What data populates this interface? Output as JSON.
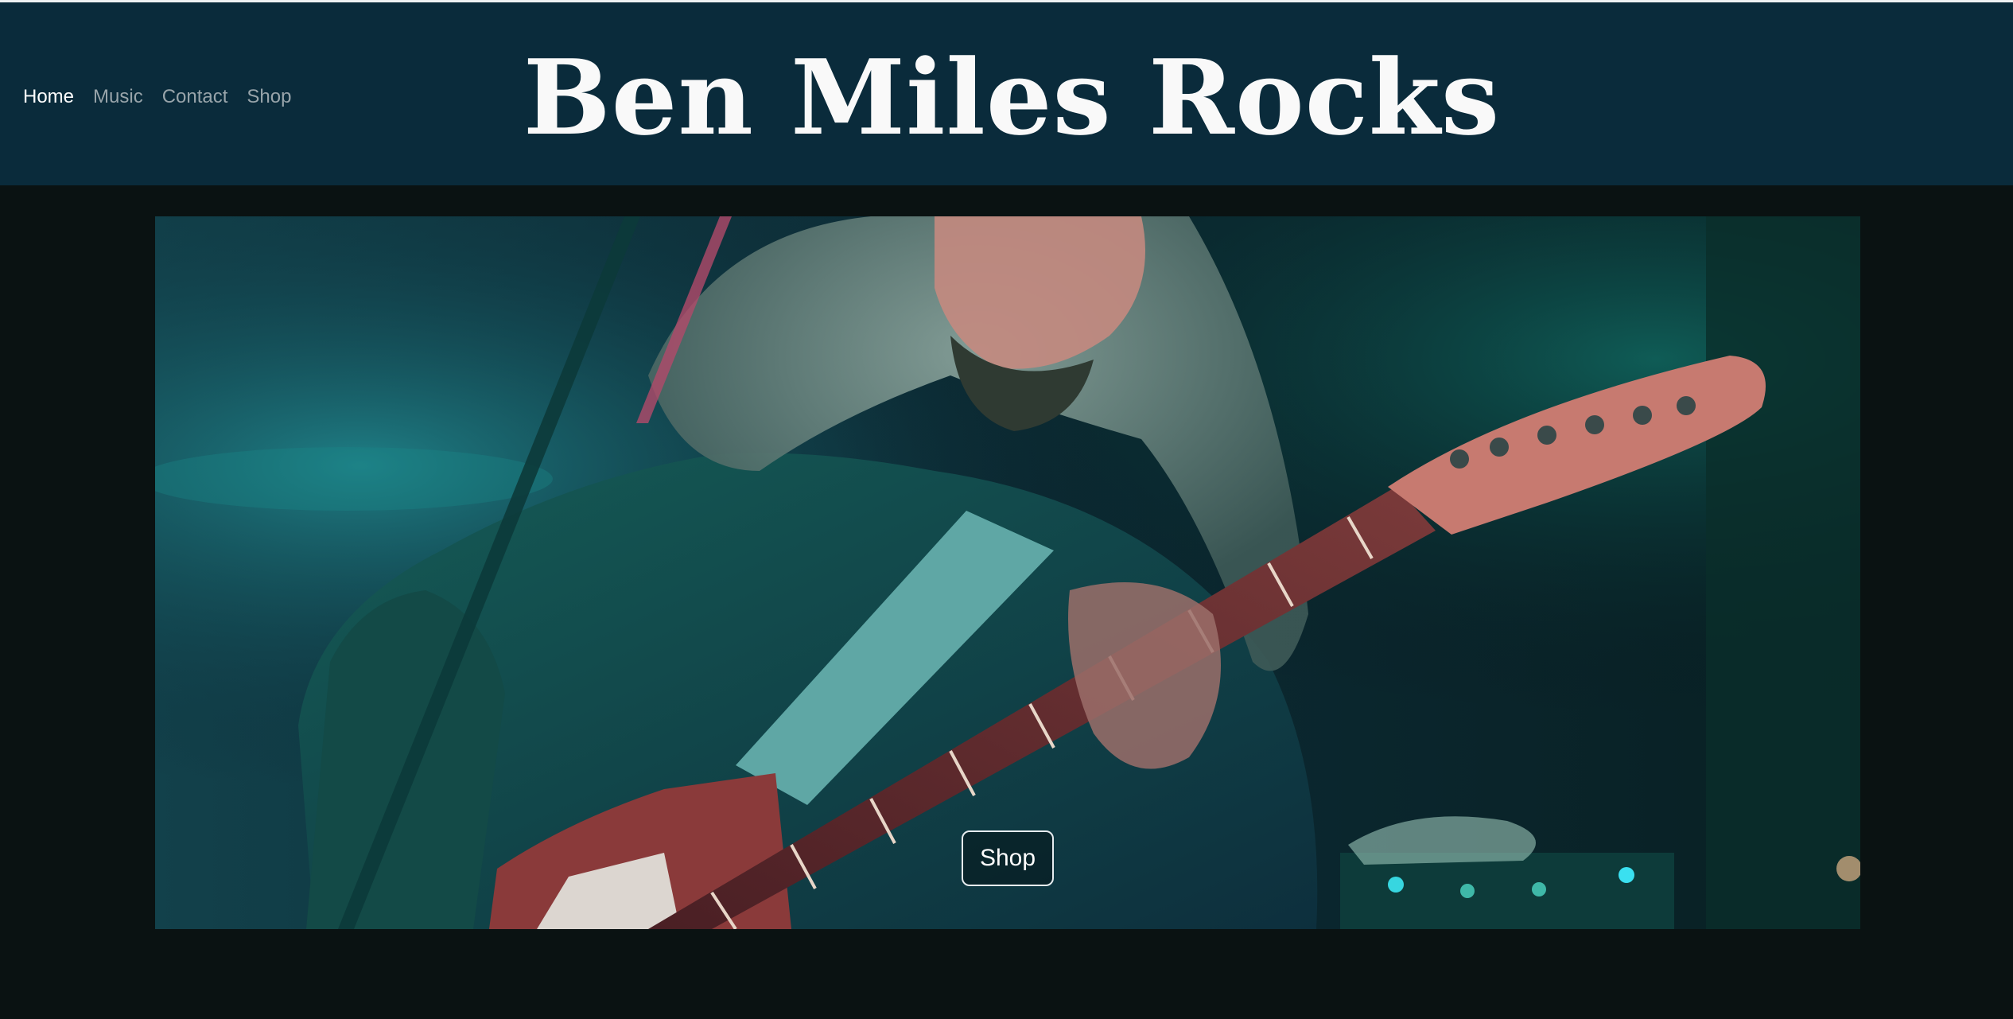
{
  "nav": {
    "items": [
      {
        "label": "Home",
        "active": true
      },
      {
        "label": "Music",
        "active": false
      },
      {
        "label": "Contact",
        "active": false
      },
      {
        "label": "Shop",
        "active": false
      }
    ]
  },
  "header": {
    "title": "Ben Miles Rocks"
  },
  "hero": {
    "cta_label": "Shop"
  },
  "colors": {
    "header_bg": "#0a2b3b",
    "page_bg": "#0a1212",
    "title_text": "#f9f9f9",
    "nav_active": "#ffffff",
    "nav_inactive": "#98a4aa"
  }
}
